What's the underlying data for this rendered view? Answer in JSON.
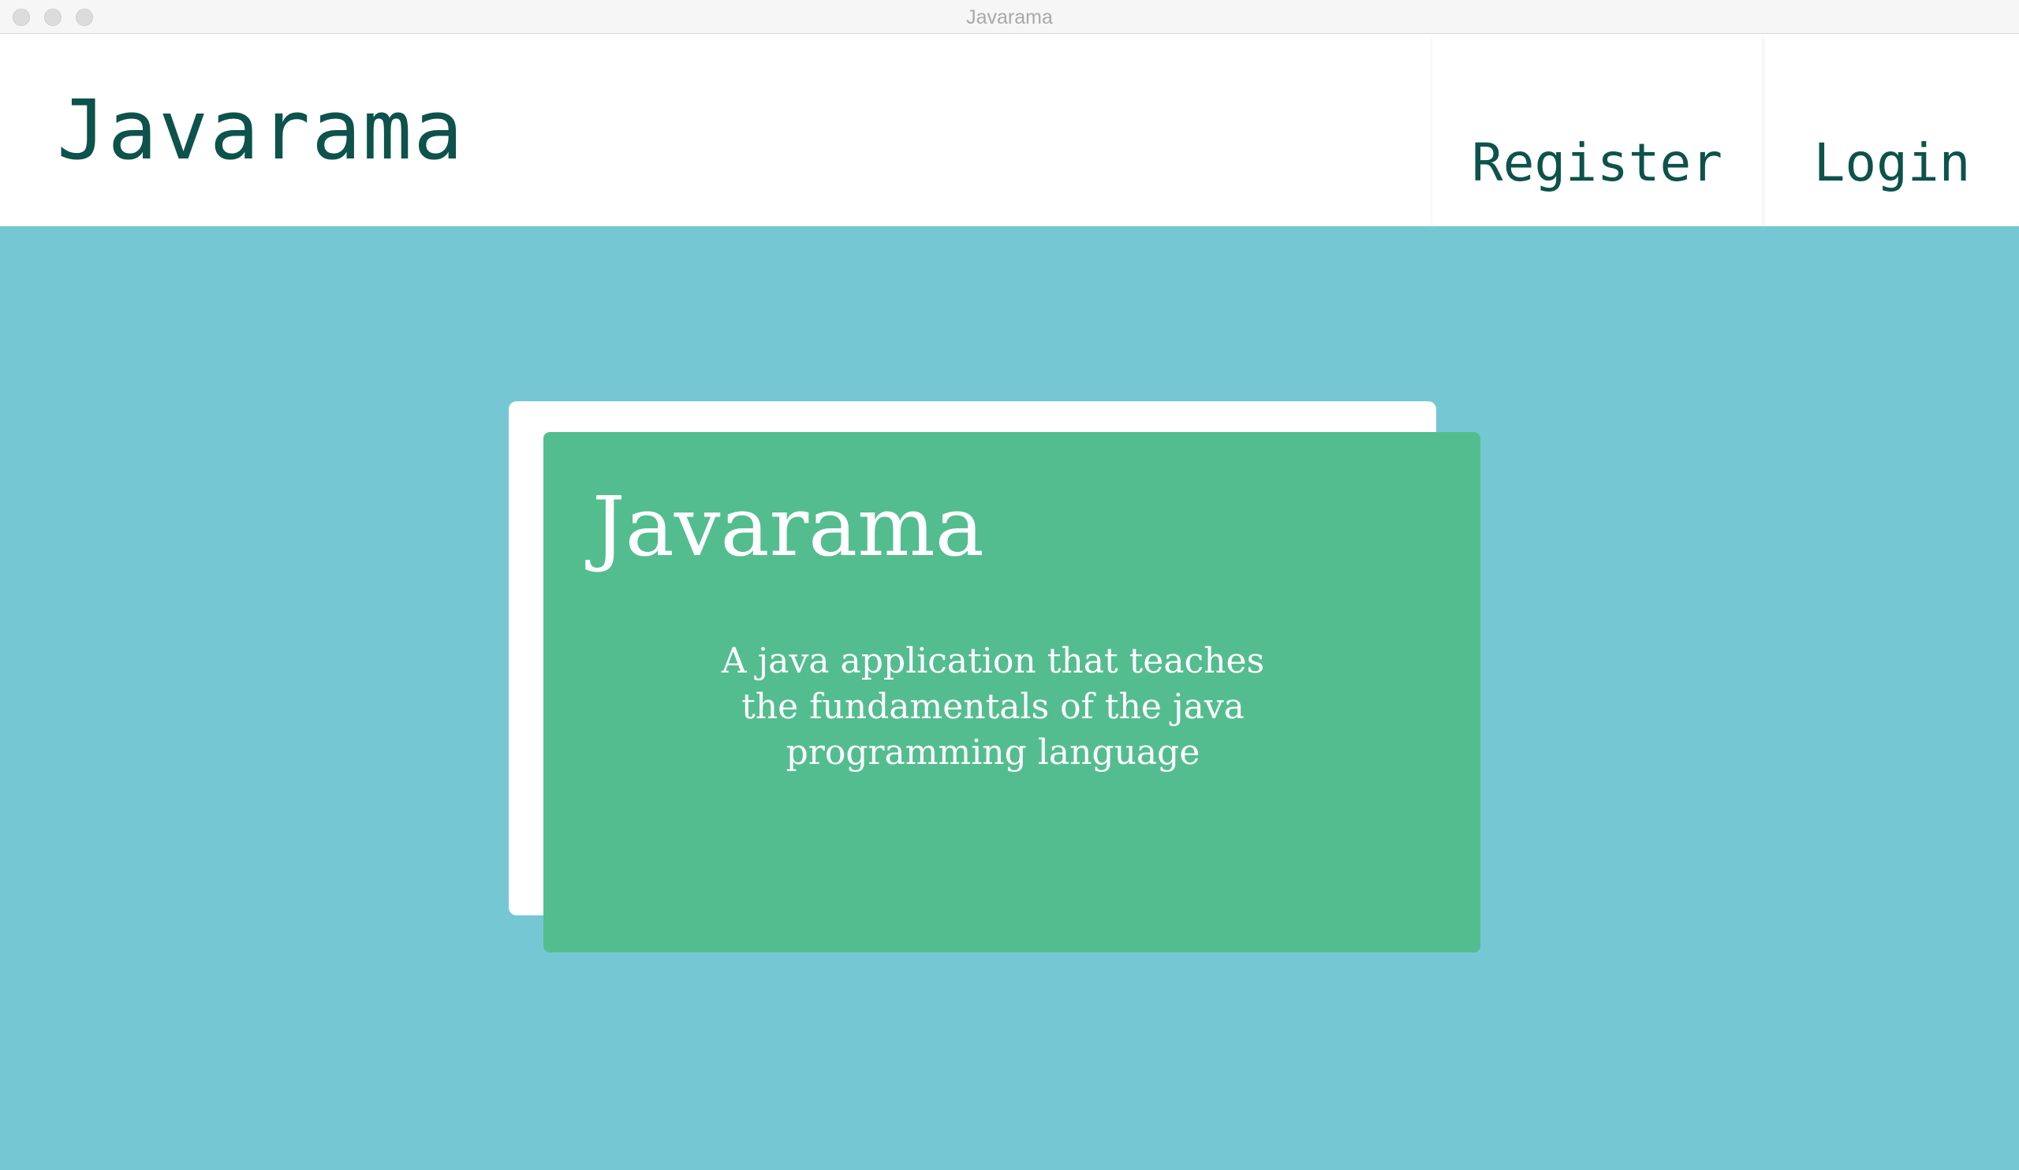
{
  "window": {
    "title": "Javarama"
  },
  "header": {
    "brand": "Javarama",
    "nav": {
      "register_label": "Register",
      "login_label": "Login"
    }
  },
  "hero": {
    "title": "Javarama",
    "description": "A java application that teaches the fundamentals of the java programming language"
  },
  "colors": {
    "brand_text": "#0d524b",
    "main_background": "#75c8d3",
    "card_green": "#54bd8f",
    "card_back": "#ffffff"
  }
}
